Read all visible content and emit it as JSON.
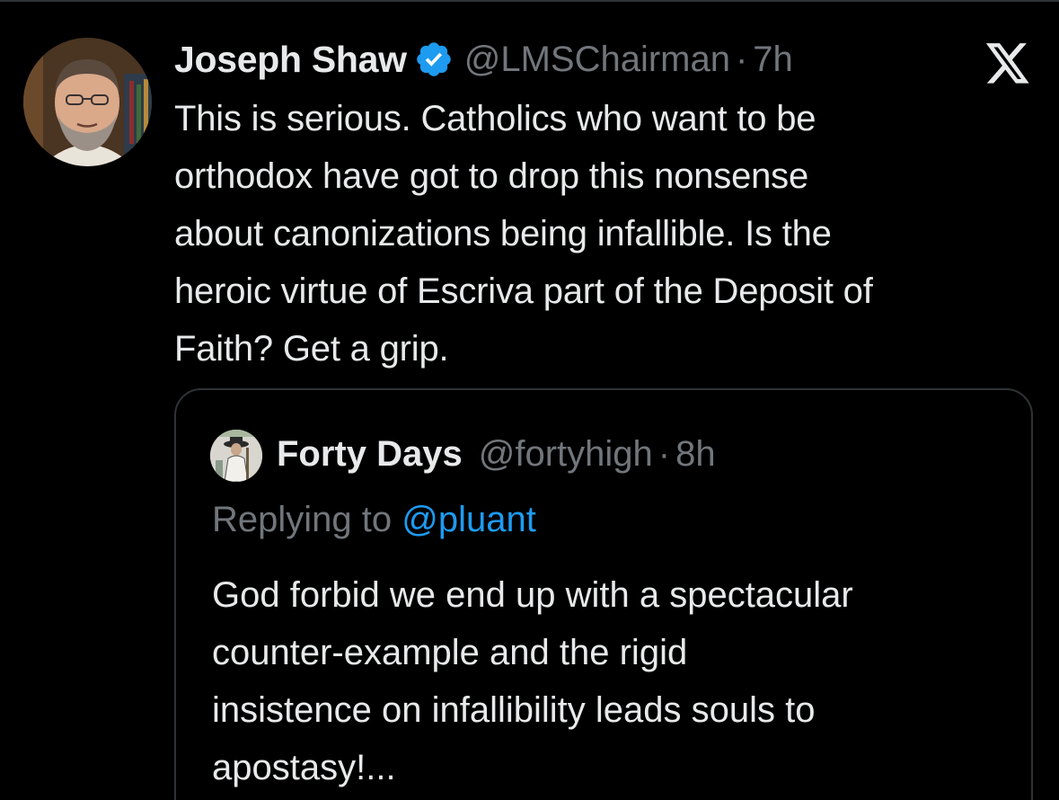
{
  "tweet": {
    "author": "Joseph Shaw",
    "handle": "@LMSChairman",
    "separator": "·",
    "time": "7h",
    "lines": [
      "This is serious. Catholics who want to be",
      "orthodox have got to drop this nonsense",
      "about canonizations being infallible. Is the",
      "heroic virtue of Escriva part of the Deposit of",
      "Faith? Get a grip."
    ],
    "avatar_icon": "profile-photo"
  },
  "quoted": {
    "author": "Forty Days",
    "handle": "@fortyhigh",
    "separator": "·",
    "time": "8h",
    "replying_prefix": "Replying to",
    "replying_to": "@pluant",
    "lines": [
      "God forbid we end up with a spectacular",
      "counter-example and the rigid",
      "insistence on infallibility leads souls to",
      "apostasy!..."
    ]
  },
  "colors": {
    "background": "#000000",
    "text": "#e7e9ea",
    "muted": "#71767b",
    "link": "#1d9bf0",
    "verified": "#1d9bf0",
    "border": "#2f3336"
  },
  "icons": {
    "platform": "x-logo-icon",
    "verified": "verified-badge-icon"
  }
}
